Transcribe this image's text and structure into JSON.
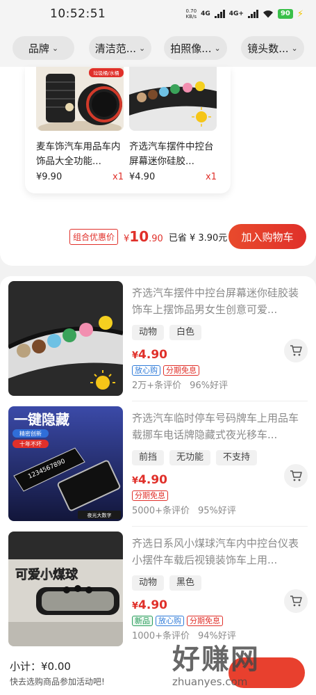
{
  "status_bar": {
    "time": "10:52:51",
    "net_speed_value": "0.70",
    "net_speed_unit": "KB/s",
    "sim1": "4G",
    "sim2": "4G+",
    "battery": "90"
  },
  "filters": [
    {
      "label": "品牌"
    },
    {
      "label": "清洁范..."
    },
    {
      "label": "拍照像..."
    },
    {
      "label": "镜头数..."
    }
  ],
  "bundle": {
    "items": [
      {
        "title": "麦车饰汽车用品车内饰品大全功能...",
        "price": "¥9.90",
        "qty": "x1",
        "image": "trash-bin-product",
        "image_label": "垃圾桶/水桶"
      },
      {
        "title": "齐选汽车摆件中控台屏幕迷你硅胶...",
        "price": "¥4.90",
        "qty": "x1",
        "image": "mini-figurines-product"
      }
    ],
    "combo_tag": "组合优惠价",
    "combo_currency": "¥",
    "combo_price_int": "10",
    "combo_price_dec": ".90",
    "save_text": "已省 ¥ 3.90元",
    "add_to_cart": "加入购物车"
  },
  "products": [
    {
      "title": "齐选汽车摆件中控台屏幕迷你硅胶装饰车上摆饰品男女生创意可爱...",
      "tags": [
        "动物",
        "白色"
      ],
      "price_symbol": "¥",
      "price": "4.90",
      "badges": [
        {
          "text": "放心购",
          "color": "blue"
        },
        {
          "text": "分期免息",
          "color": "red"
        }
      ],
      "review_count": "2万+条评价",
      "rating": "96%好评",
      "image": "silicone-figurines-on-dashboard"
    },
    {
      "title": "齐选汽车临时停车号码牌车上用品车载挪车电话牌隐藏式夜光移车...",
      "tags": [
        "前挡",
        "无功能",
        "不支持"
      ],
      "price_symbol": "¥",
      "price": "4.90",
      "badges": [
        {
          "text": "分期免息",
          "color": "red"
        }
      ],
      "review_count": "5000+条评价",
      "rating": "95%好评",
      "image": "hidden-parking-number-plate",
      "image_text": {
        "headline": "一键隐藏",
        "pill1": "精密创新",
        "pill2": "十年不坏",
        "plate_digits": "1234567890",
        "corner": "夜光大数字"
      }
    },
    {
      "title": "齐选日系风小煤球汽车内中控台仪表小摆件车载后视镜装饰车上用...",
      "tags": [
        "动物",
        "黑色"
      ],
      "price_symbol": "¥",
      "price": "4.90",
      "badges": [
        {
          "text": "新品",
          "color": "green"
        },
        {
          "text": "放心购",
          "color": "blue"
        },
        {
          "text": "分期免息",
          "color": "red"
        }
      ],
      "review_count": "1000+条评价",
      "rating": "94%好评",
      "image": "soot-sprite-on-rearview-mirror",
      "image_text": {
        "headline": "可爱小煤球"
      }
    }
  ],
  "bottom_bar": {
    "subtotal": "小计：¥0.00",
    "hint": "快去选购商品参加活动吧!"
  },
  "watermark": {
    "brand": "好赚网",
    "domain": "zhuanyes.com"
  },
  "colors": {
    "accent": "#e0302a",
    "blue_badge": "#2f7bd8",
    "green_badge": "#2a9d5c",
    "background": "#f2f2f2"
  }
}
